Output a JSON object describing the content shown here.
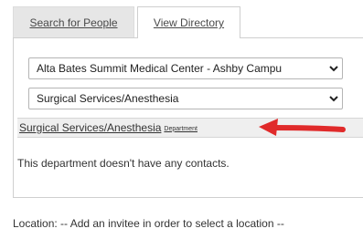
{
  "tabs": {
    "search_label": "Search for People",
    "directory_label": "View Directory"
  },
  "directory": {
    "facility_select": {
      "value": "Alta Bates Summit Medical Center - Ashby Campu"
    },
    "department_select": {
      "value": "Surgical Services/Anesthesia"
    },
    "result": {
      "name": "Surgical Services/Anesthesia",
      "type_label": "Department"
    },
    "empty_message": "This department doesn't have any contacts."
  },
  "location": {
    "text": "Location: -- Add an invitee in order to select a location --"
  },
  "colors": {
    "arrow": "#e02a2a",
    "tab_inactive_bg": "#e6e6e6",
    "result_row_bg": "#efefef"
  },
  "icons": {
    "select_chevron": "chevron-down-icon",
    "annotation": "red-arrow-icon"
  }
}
